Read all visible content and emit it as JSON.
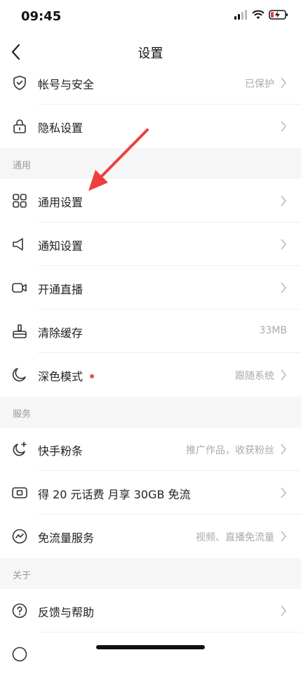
{
  "status": {
    "time": "09:45"
  },
  "nav": {
    "title": "设置"
  },
  "rows_top": [
    {
      "label": "帐号与安全",
      "value": "已保护",
      "icon": "shield-check-icon"
    },
    {
      "label": "隐私设置",
      "value": "",
      "icon": "lock-icon"
    }
  ],
  "section_general": "通用",
  "rows_general": [
    {
      "label": "通用设置",
      "value": "",
      "icon": "grid-icon"
    },
    {
      "label": "通知设置",
      "value": "",
      "icon": "speaker-icon"
    },
    {
      "label": "开通直播",
      "value": "",
      "icon": "video-camera-icon"
    },
    {
      "label": "清除缓存",
      "value": "33MB",
      "icon": "broom-icon"
    },
    {
      "label": "深色模式",
      "value": "跟随系统",
      "icon": "moon-icon"
    }
  ],
  "section_service": "服务",
  "rows_service": [
    {
      "label": "快手粉条",
      "value": "推广作品，收获粉丝",
      "icon": "rocket-icon"
    },
    {
      "label": "得 20 元话费 月享 30GB 免流",
      "value": "",
      "icon": "sim-card-icon"
    },
    {
      "label": "免流量服务",
      "value": "视频、直播免流量",
      "icon": "wave-icon"
    }
  ],
  "section_about": "关于",
  "rows_about": [
    {
      "label": "反馈与帮助",
      "value": "",
      "icon": "help-icon"
    }
  ],
  "colors": {
    "accent_red": "#f03e3e",
    "dot_red": "#f04a5a",
    "section_bg": "#f6f6f6"
  }
}
